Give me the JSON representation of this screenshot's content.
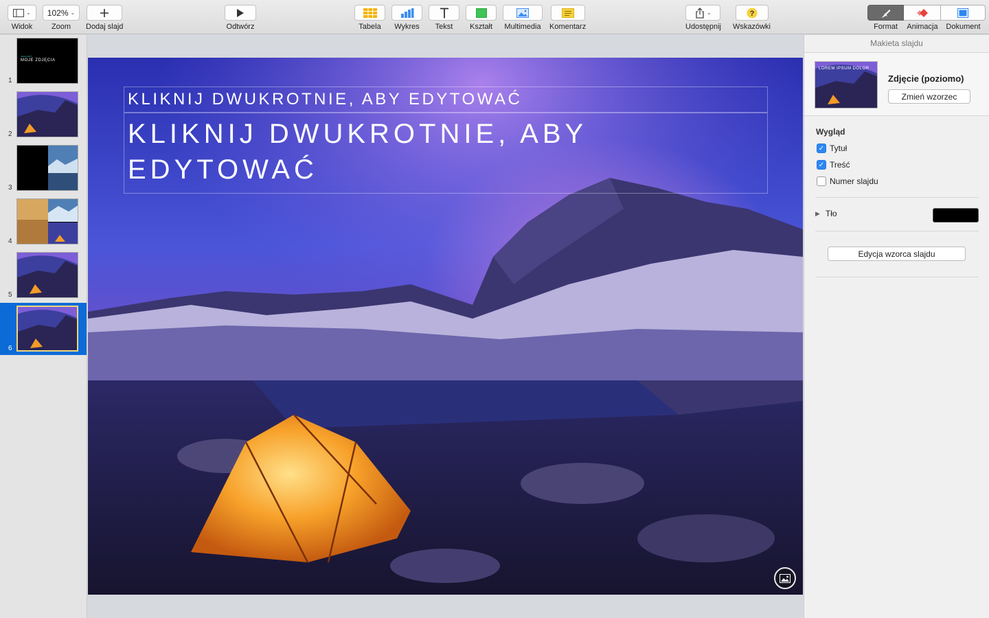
{
  "toolbar": {
    "view_label": "Widok",
    "zoom_value": "102%",
    "zoom_label": "Zoom",
    "add_slide_label": "Dodaj slajd",
    "play_label": "Odtwórz",
    "table_label": "Tabela",
    "chart_label": "Wykres",
    "text_label": "Tekst",
    "shape_label": "Kształt",
    "media_label": "Multimedia",
    "comment_label": "Komentarz",
    "share_label": "Udostępnij",
    "tips_label": "Wskazówki",
    "format_label": "Format",
    "animate_label": "Animacja",
    "document_label": "Dokument"
  },
  "navigator": {
    "slides": [
      {
        "number": "1",
        "kicker": "Jesień 2017",
        "title": "MOJE ZDJĘCIA"
      },
      {
        "number": "2"
      },
      {
        "number": "3"
      },
      {
        "number": "4"
      },
      {
        "number": "5"
      },
      {
        "number": "6"
      }
    ],
    "selected_index": 6
  },
  "slide": {
    "subtitle_placeholder": "KLIKNIJ DWUKROTNIE, ABY EDYTOWAĆ",
    "title_placeholder": "KLIKNIJ DWUKROTNIE, ABY EDYTOWAĆ"
  },
  "inspector": {
    "header": "Makieta slajdu",
    "master_name": "Zdjęcie (poziomo)",
    "master_thumb_text": "LOREM IPSUM DOLOR",
    "change_master_label": "Zmień wzorzec",
    "appearance_title": "Wygląd",
    "checks": [
      {
        "label": "Tytuł",
        "checked": true
      },
      {
        "label": "Treść",
        "checked": true
      },
      {
        "label": "Numer slajdu",
        "checked": false
      }
    ],
    "background_label": "Tło",
    "background_color": "#000000",
    "edit_master_label": "Edycja wzorca slajdu"
  },
  "colors": {
    "accent": "#0d6bd8",
    "checkbox": "#2d86f3"
  }
}
